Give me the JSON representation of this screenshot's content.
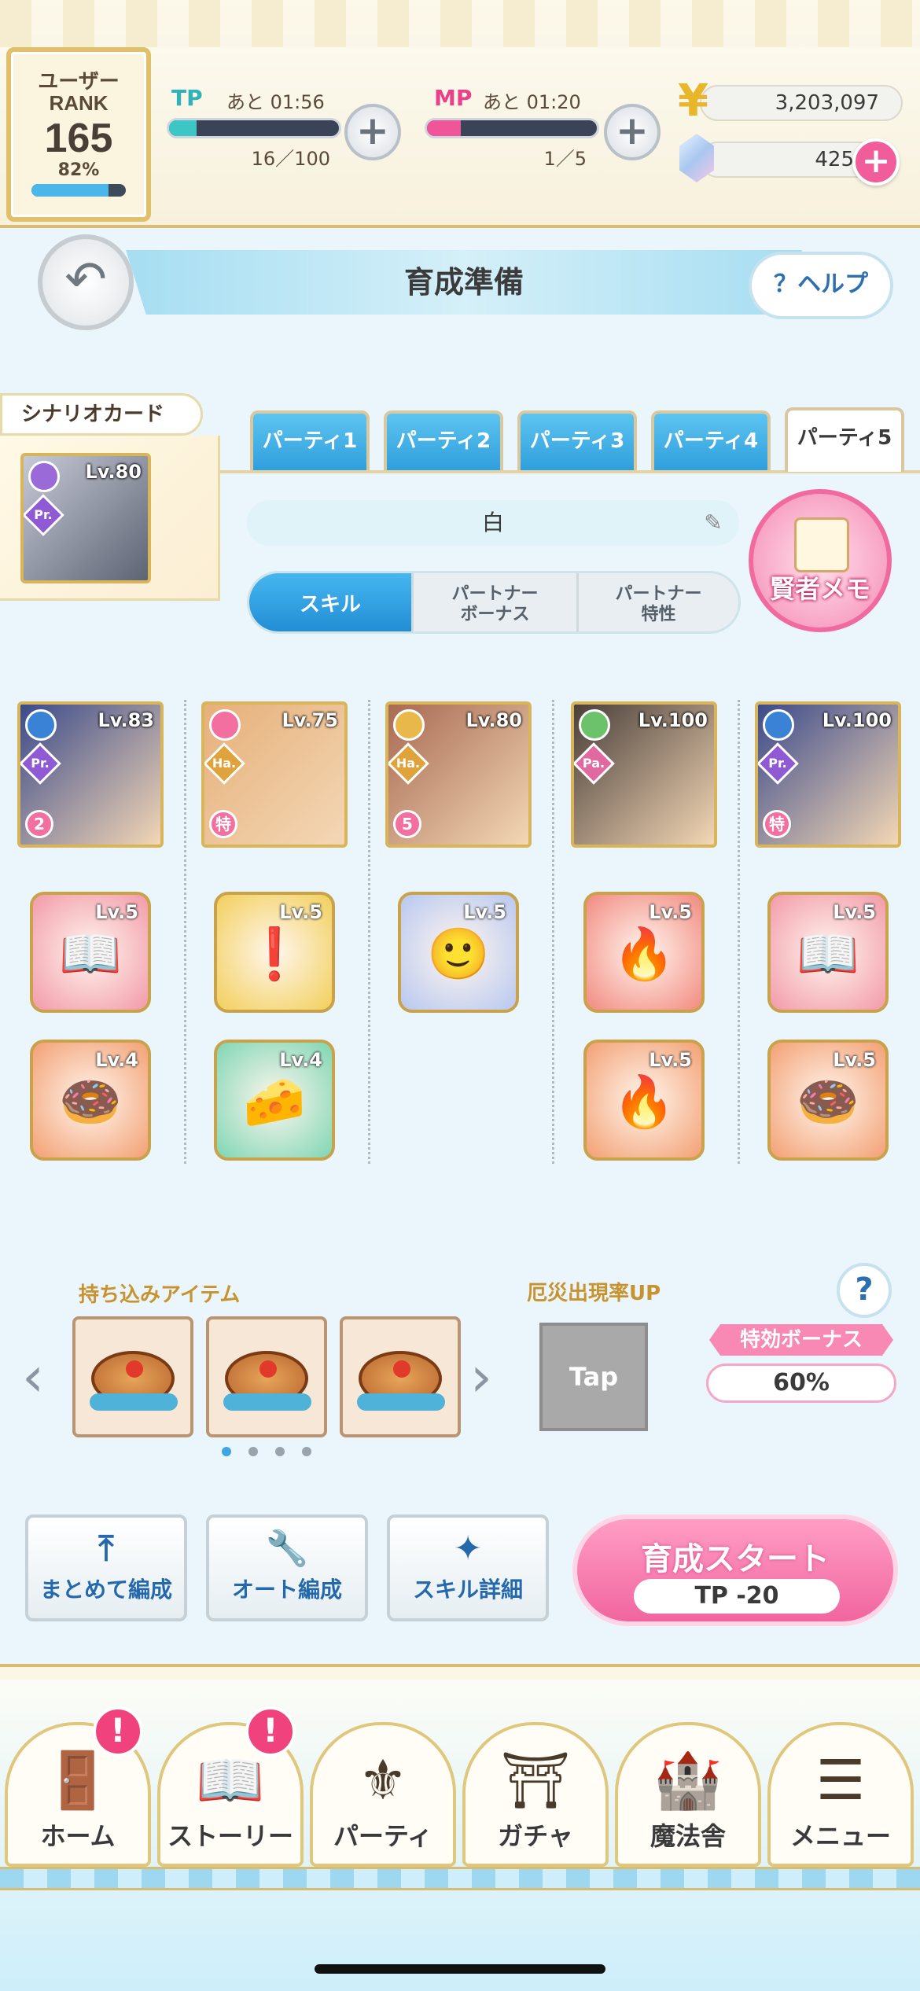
{
  "header": {
    "rank_label_1": "ユーザー",
    "rank_label_2": "RANK",
    "rank_value": "165",
    "rank_percent": "82%",
    "rank_progress": 0.82,
    "tp": {
      "label": "TP",
      "time": "あと 01:56",
      "count": "16／100",
      "fill": 0.16,
      "color": "#3cc6c6"
    },
    "mp": {
      "label": "MP",
      "time": "あと 01:20",
      "count": "1／5",
      "fill": 0.2,
      "color": "#f0559a"
    },
    "gold": "3,203,097",
    "gems": "425"
  },
  "page": {
    "title": "育成準備",
    "help_label": "ヘルプ"
  },
  "scenario": {
    "label": "シナリオカード",
    "card_level": "Lv.80",
    "card_type": "Pr."
  },
  "tabs": [
    "パーティ1",
    "パーティ2",
    "パーティ3",
    "パーティ4",
    "パーティ5"
  ],
  "active_tab": 4,
  "party": {
    "name": "白",
    "segments": [
      "スキル",
      "パートナー\nボーナス",
      "パートナー\n特性"
    ],
    "memo_label": "賢者メモ"
  },
  "characters": [
    {
      "level": "Lv.83",
      "type": "Pr.",
      "badge": "2",
      "attr_color": "#3a82d6",
      "type_color": "#8f5ad3",
      "bg": "#3b4a8a",
      "skills": [
        {
          "level": "Lv.5",
          "glyph": "📖",
          "color": "#f29aa8"
        },
        {
          "level": "Lv.4",
          "glyph": "🍩",
          "color": "#f3a073"
        }
      ]
    },
    {
      "level": "Lv.75",
      "type": "Ha.",
      "badge": "特",
      "attr_color": "#f26fa0",
      "type_color": "#e0a23a",
      "bg": "#e6b07a",
      "skills": [
        {
          "level": "Lv.5",
          "glyph": "❗",
          "color": "#f2cf5a"
        },
        {
          "level": "Lv.4",
          "glyph": "🧀",
          "color": "#7fd6b4"
        }
      ]
    },
    {
      "level": "Lv.80",
      "type": "Ha.",
      "badge": "5",
      "attr_color": "#e8b94a",
      "type_color": "#e0a23a",
      "bg": "#a86a52",
      "skills": [
        {
          "level": "Lv.5",
          "glyph": "🙂",
          "color": "#b8c8f0"
        }
      ]
    },
    {
      "level": "Lv.100",
      "type": "Pa.",
      "badge": "",
      "attr_color": "#6cc26a",
      "type_color": "#e06aa0",
      "bg": "#4a3f3a",
      "skills": [
        {
          "level": "Lv.5",
          "glyph": "🔥",
          "color": "#f28a80"
        },
        {
          "level": "Lv.5",
          "glyph": "🔥",
          "color": "#f3a073"
        }
      ]
    },
    {
      "level": "Lv.100",
      "type": "Pr.",
      "badge": "特",
      "attr_color": "#3a82d6",
      "type_color": "#8f5ad3",
      "bg": "#3b4a8a",
      "skills": [
        {
          "level": "Lv.5",
          "glyph": "📖",
          "color": "#f29aa8"
        },
        {
          "level": "Lv.5",
          "glyph": "🍩",
          "color": "#f3a073"
        }
      ]
    }
  ],
  "items": {
    "label": "持ち込みアイテム",
    "count": 3,
    "page_dots": 4,
    "active_dot": 0,
    "disaster_label": "厄災出現率UP",
    "tap_label": "Tap",
    "bonus_label": "特効ボーナス",
    "bonus_value": "60%"
  },
  "actions": [
    {
      "label": "まとめて編成",
      "icon": "upload-icon",
      "glyph": "⤒"
    },
    {
      "label": "オート編成",
      "icon": "wrench-icon",
      "glyph": "🔧"
    },
    {
      "label": "スキル詳細",
      "icon": "sparkle-icon",
      "glyph": "✦"
    }
  ],
  "start": {
    "label": "育成スタート",
    "cost": "TP -20"
  },
  "nav": [
    {
      "label": "ホーム",
      "icon": "door-icon",
      "glyph": "🚪",
      "alert": true
    },
    {
      "label": "ストーリー",
      "icon": "book-icon",
      "glyph": "📖",
      "alert": true
    },
    {
      "label": "パーティ",
      "icon": "lily-icon",
      "glyph": "⚜",
      "alert": false
    },
    {
      "label": "ガチャ",
      "icon": "gate-icon",
      "glyph": "⛩",
      "alert": false
    },
    {
      "label": "魔法舎",
      "icon": "castle-icon",
      "glyph": "🏰",
      "alert": false
    },
    {
      "label": "メニュー",
      "icon": "list-icon",
      "glyph": "☰",
      "alert": false
    }
  ],
  "alert_glyph": "!"
}
